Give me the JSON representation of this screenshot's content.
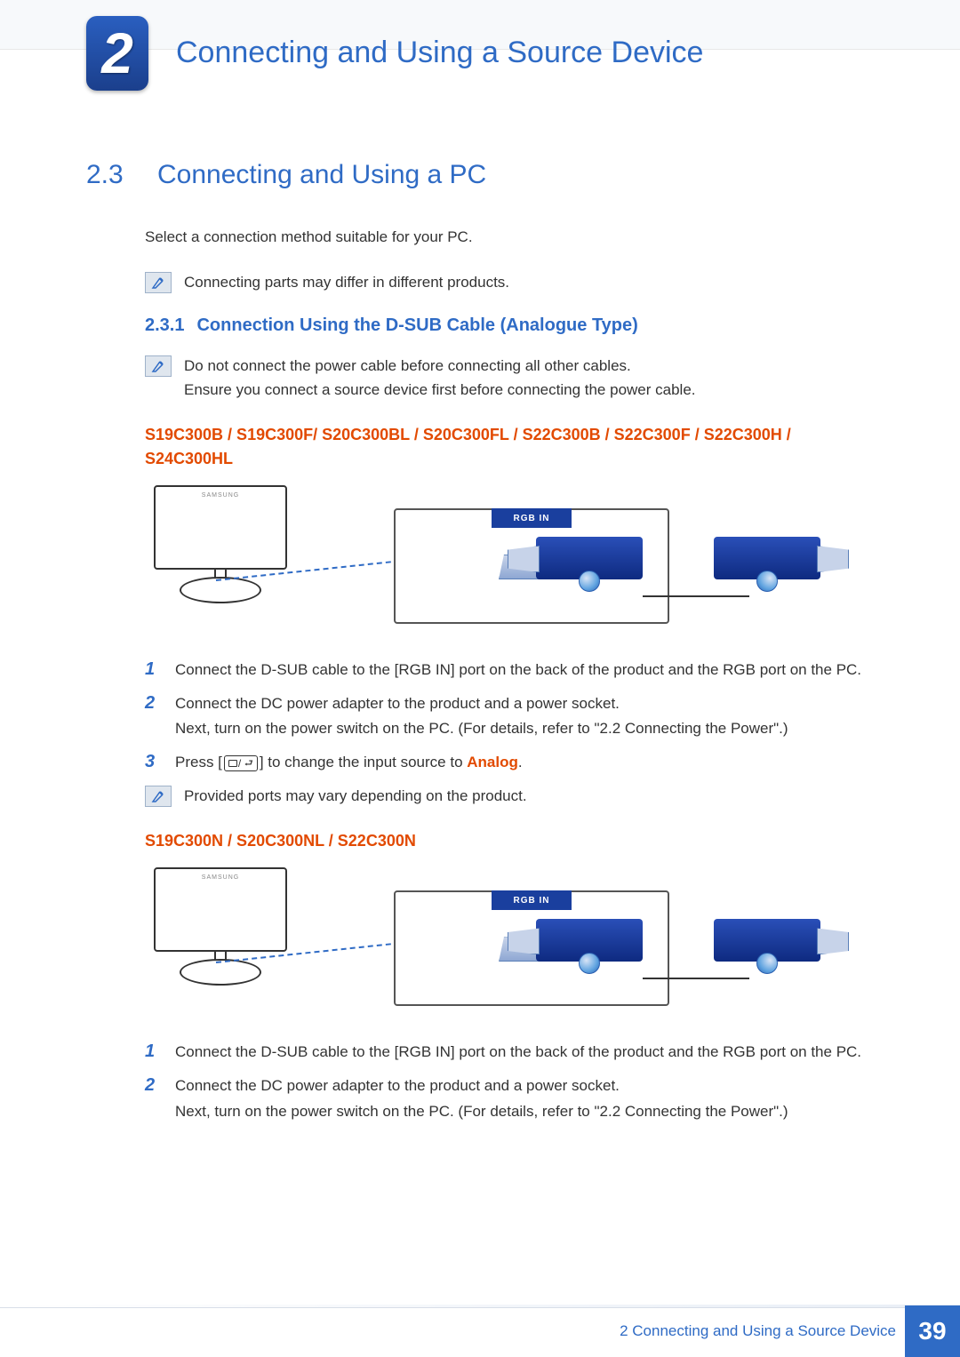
{
  "header": {
    "chapter_number": "2",
    "chapter_title": "Connecting and Using a Source Device"
  },
  "section": {
    "number": "2.3",
    "title": "Connecting and Using a PC",
    "intro": "Select a connection method suitable for your PC.",
    "note_intro": "Connecting parts may differ in different products."
  },
  "subsection": {
    "number": "2.3.1",
    "title": "Connection Using the D-SUB Cable (Analogue Type)",
    "note_line1": "Do not connect the power cable before connecting all other cables.",
    "note_line2": "Ensure you connect a source device first before connecting the power cable."
  },
  "group1": {
    "models": "S19C300B / S19C300F/ S20C300BL / S20C300FL / S22C300B / S22C300F / S22C300H / S24C300HL",
    "port_label": "RGB IN",
    "steps": {
      "n1": "1",
      "t1": "Connect the D-SUB cable to the [RGB IN] port on the back of the product and the RGB port on the PC.",
      "n2": "2",
      "t2a": "Connect the DC power adapter to the product and a power socket.",
      "t2b": "Next, turn on the power switch on the PC. (For details, refer to \"2.2 Connecting the Power\".)",
      "n3": "3",
      "t3a": "Press [",
      "t3b": "] to change the input source to ",
      "t3_analog": "Analog",
      "t3c": "."
    },
    "end_note": "Provided ports may vary depending on the product."
  },
  "group2": {
    "models": "S19C300N / S20C300NL / S22C300N",
    "port_label": "RGB IN",
    "steps": {
      "n1": "1",
      "t1": "Connect the D-SUB cable to the [RGB IN] port on the back of the product and the RGB port on the PC.",
      "n2": "2",
      "t2a": "Connect the DC power adapter to the product and a power socket.",
      "t2b": "Next, turn on the power switch on the PC. (For details, refer to \"2.2 Connecting the Power\".)"
    }
  },
  "footer": {
    "chapter_ref": "2 Connecting and Using a Source Device",
    "page": "39"
  }
}
